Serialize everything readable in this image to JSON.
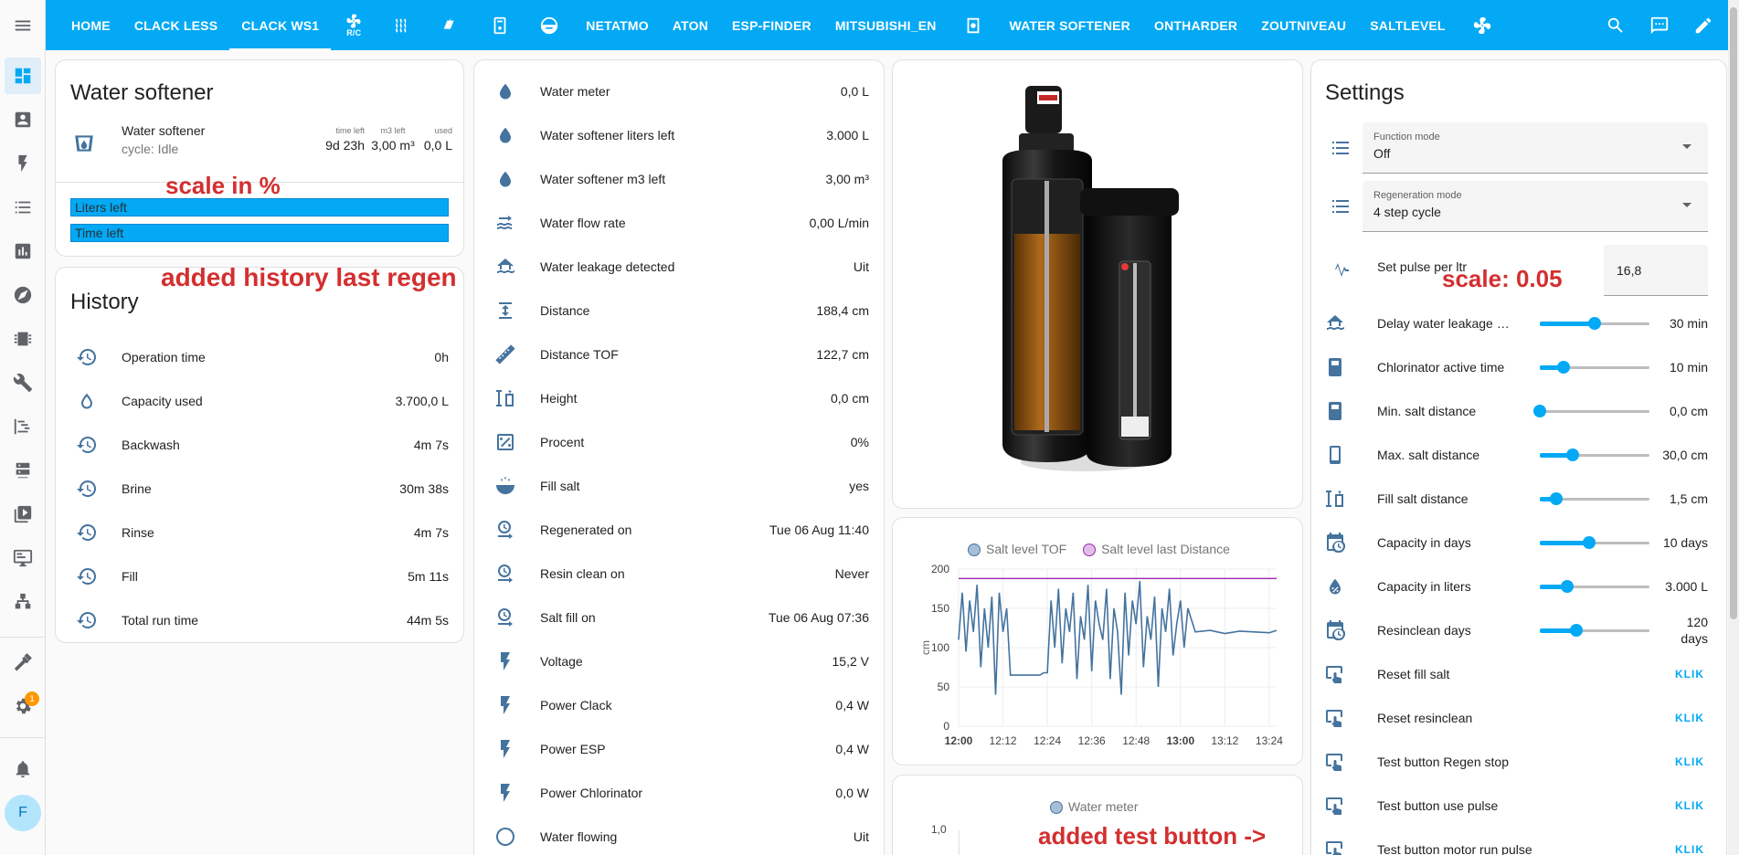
{
  "topbar": {
    "tabs": [
      {
        "label": "HOME",
        "type": "text"
      },
      {
        "label": "CLACK LESS",
        "type": "text"
      },
      {
        "label": "CLACK WS1",
        "type": "text",
        "active": true
      },
      {
        "label": "R/C",
        "type": "icon",
        "icon": "fan-icon"
      },
      {
        "type": "icon",
        "icon": "heat-wave-icon"
      },
      {
        "type": "icon",
        "icon": "solar-power-icon"
      },
      {
        "type": "icon",
        "icon": "water-heater-icon"
      },
      {
        "type": "icon",
        "icon": "robot-vacuum-icon"
      },
      {
        "label": "NETATMO",
        "type": "text"
      },
      {
        "label": "ATON",
        "type": "text"
      },
      {
        "label": "ESP-FINDER",
        "type": "text"
      },
      {
        "label": "MITSUBISHI_EN",
        "type": "text"
      },
      {
        "type": "icon",
        "icon": "washing-machine-icon"
      },
      {
        "label": "WATER SOFTENER",
        "type": "text"
      },
      {
        "label": "ONTHARDER",
        "type": "text"
      },
      {
        "label": "ZOUTNIVEAU",
        "type": "text"
      },
      {
        "label": "SALTLEVEL",
        "type": "text"
      },
      {
        "type": "icon",
        "icon": "fan-icon"
      }
    ],
    "actions": [
      "search-icon",
      "assist-icon",
      "edit-icon"
    ]
  },
  "sidebar": {
    "badge": "1",
    "avatar_letter": "F"
  },
  "annotations": {
    "scale_percent": "scale in %",
    "history": "added history last regen",
    "scale_005": "scale: 0.05",
    "test_button": "added test button ->"
  },
  "softener_card": {
    "title": "Water softener",
    "entity_name": "Water softener",
    "entity_state": "cycle: Idle",
    "stats": [
      {
        "label": "time left",
        "value": "9d 23h"
      },
      {
        "label": "m3 left",
        "value": "3,00 m³"
      },
      {
        "label": "used",
        "value": "0,0 L"
      }
    ],
    "bars": [
      {
        "label": "Liters left",
        "level_percent": 100
      },
      {
        "label": "Time left",
        "level_percent": 100
      }
    ]
  },
  "history_card": {
    "title": "History",
    "rows": [
      {
        "label": "Operation time",
        "value": "0h",
        "icon": "history-icon"
      },
      {
        "label": "Capacity used",
        "value": "3.700,0 L",
        "icon": "water-outline-icon"
      },
      {
        "label": "Backwash",
        "value": "4m 7s",
        "icon": "history-icon"
      },
      {
        "label": "Brine",
        "value": "30m 38s",
        "icon": "history-icon"
      },
      {
        "label": "Rinse",
        "value": "4m 7s",
        "icon": "history-icon"
      },
      {
        "label": "Fill",
        "value": "5m 11s",
        "icon": "history-icon"
      },
      {
        "label": "Total run time",
        "value": "44m 5s",
        "icon": "history-icon"
      }
    ]
  },
  "entities_card": {
    "rows": [
      {
        "label": "Water meter",
        "value": "0,0 L",
        "icon": "water-icon"
      },
      {
        "label": "Water softener liters left",
        "value": "3.000 L",
        "icon": "water-icon"
      },
      {
        "label": "Water softener m3 left",
        "value": "3,00 m³",
        "icon": "water-icon"
      },
      {
        "label": "Water flow rate",
        "value": "0,00 L/min",
        "icon": "flow-icon"
      },
      {
        "label": "Water leakage detected",
        "value": "Uit",
        "icon": "home-flood-icon"
      },
      {
        "label": "Distance",
        "value": "188,4 cm",
        "icon": "arrow-expand-vertical-icon"
      },
      {
        "label": "Distance TOF",
        "value": "122,7 cm",
        "icon": "ruler-icon"
      },
      {
        "label": "Height",
        "value": "0,0 cm",
        "icon": "height-icon"
      },
      {
        "label": "Procent",
        "value": "0%",
        "icon": "percent-box-icon"
      },
      {
        "label": "Fill salt",
        "value": "yes",
        "icon": "bowl-icon"
      },
      {
        "label": "Regenerated on",
        "value": "Tue 06 Aug 11:40",
        "icon": "clock-arrow-icon"
      },
      {
        "label": "Resin clean on",
        "value": "Never",
        "icon": "clock-arrow-icon"
      },
      {
        "label": "Salt fill on",
        "value": "Tue 06 Aug 07:36",
        "icon": "clock-arrow-icon"
      },
      {
        "label": "Voltage",
        "value": "15,2 V",
        "icon": "flash-icon"
      },
      {
        "label": "Power Clack",
        "value": "0,4 W",
        "icon": "flash-icon"
      },
      {
        "label": "Power ESP",
        "value": "0,4 W",
        "icon": "flash-icon"
      },
      {
        "label": "Power Chlorinator",
        "value": "0,0 W",
        "icon": "flash-icon"
      },
      {
        "label": "Water flowing",
        "value": "Uit",
        "icon": "circle-outline-icon"
      }
    ]
  },
  "chart_data": [
    {
      "type": "line",
      "series": [
        {
          "name": "Salt level TOF",
          "color": "#44739e",
          "x": [
            "12:00",
            "12:01",
            "12:02",
            "12:03",
            "12:04",
            "12:05",
            "12:06",
            "12:07",
            "12:08",
            "12:09",
            "12:10",
            "12:11",
            "12:12",
            "12:13",
            "12:14",
            "12:15",
            "12:16",
            "12:17",
            "12:18",
            "12:19",
            "12:20",
            "12:21",
            "12:22",
            "12:23",
            "12:24",
            "12:25",
            "12:26",
            "12:27",
            "12:28",
            "12:29",
            "12:30",
            "12:31",
            "12:32",
            "12:33",
            "12:34",
            "12:35",
            "12:36",
            "12:37",
            "12:38",
            "12:39",
            "12:40",
            "12:41",
            "12:42",
            "12:43",
            "12:44",
            "12:45",
            "12:46",
            "12:47",
            "12:48",
            "12:49",
            "12:50",
            "12:51",
            "12:52",
            "12:53",
            "12:54",
            "12:55",
            "12:56",
            "12:57",
            "12:58",
            "12:59",
            "13:00",
            "13:01",
            "13:02",
            "13:04",
            "13:08",
            "13:12",
            "13:16",
            "13:20",
            "13:24",
            "13:26"
          ],
          "values": [
            110,
            170,
            95,
            160,
            120,
            180,
            75,
            150,
            100,
            165,
            40,
            170,
            120,
            150,
            65,
            65,
            65,
            65,
            65,
            65,
            65,
            65,
            65,
            68,
            68,
            160,
            100,
            175,
            80,
            150,
            120,
            170,
            60,
            140,
            110,
            180,
            70,
            160,
            130,
            110,
            175,
            60,
            150,
            120,
            40,
            170,
            90,
            160,
            130,
            185,
            75,
            140,
            110,
            165,
            50,
            150,
            120,
            175,
            90,
            130,
            160,
            100,
            150,
            120,
            122,
            118,
            121,
            120,
            119,
            122
          ]
        },
        {
          "name": "Salt level last Distance",
          "color": "#9c27b0",
          "x": [
            "12:00",
            "13:26"
          ],
          "values": [
            188,
            188
          ]
        }
      ],
      "x_ticks": [
        "12:00",
        "12:12",
        "12:24",
        "12:36",
        "12:48",
        "13:00",
        "13:12",
        "13:24"
      ],
      "ylabel": "cm",
      "ylim": [
        0,
        200
      ],
      "y_ticks": [
        0,
        50,
        100,
        150,
        200
      ],
      "legend": "top"
    },
    {
      "type": "line",
      "series": [
        {
          "name": "Water meter",
          "color": "#44739e",
          "values": []
        }
      ],
      "y_ticks": [
        1.0
      ],
      "y_tick_labels": [
        "1,0"
      ],
      "legend": "top"
    }
  ],
  "settings_card": {
    "title": "Settings",
    "selects": [
      {
        "label": "Function mode",
        "value": "Off",
        "icon": "format-list-icon"
      },
      {
        "label": "Regeneration mode",
        "value": "4 step cycle",
        "icon": "format-list-icon"
      }
    ],
    "pulse": {
      "label": "Set pulse per ltr",
      "value": "16,8",
      "icon": "pulse-icon"
    },
    "sliders": [
      {
        "label": "Delay water leakage al...",
        "value": "30 min",
        "level": 0.5,
        "icon": "home-flood-icon"
      },
      {
        "label": "Chlorinator active time",
        "value": "10 min",
        "level": 0.22,
        "icon": "chlorinator-icon"
      },
      {
        "label": "Min. salt distance",
        "value": "0,0 cm",
        "level": 0.0,
        "icon": "chlorinator-icon"
      },
      {
        "label": "Max. salt distance",
        "value": "30,0 cm",
        "level": 0.3,
        "icon": "phone-icon"
      },
      {
        "label": "Fill salt distance",
        "value": "1,5 cm",
        "level": 0.15,
        "icon": "height-icon"
      },
      {
        "label": "Capacity in days",
        "value": "10 days",
        "level": 0.45,
        "icon": "calendar-clock-icon"
      },
      {
        "label": "Capacity in liters",
        "value": "3.000 L",
        "level": 0.25,
        "icon": "water-percent-icon"
      },
      {
        "label": "Resinclean days",
        "value": "120 days",
        "level": 0.33,
        "icon": "calendar-clock-icon"
      }
    ],
    "buttons": [
      {
        "label": "Reset fill salt",
        "action": "KLIK",
        "icon": "gesture-tap-icon"
      },
      {
        "label": "Reset resinclean",
        "action": "KLIK",
        "icon": "gesture-tap-icon"
      },
      {
        "label": "Test button Regen stop",
        "action": "KLIK",
        "icon": "gesture-tap-icon"
      },
      {
        "label": "Test button use pulse",
        "action": "KLIK",
        "icon": "gesture-tap-icon"
      },
      {
        "label": "Test button motor run pulse",
        "action": "KLIK",
        "icon": "gesture-tap-icon"
      }
    ]
  }
}
